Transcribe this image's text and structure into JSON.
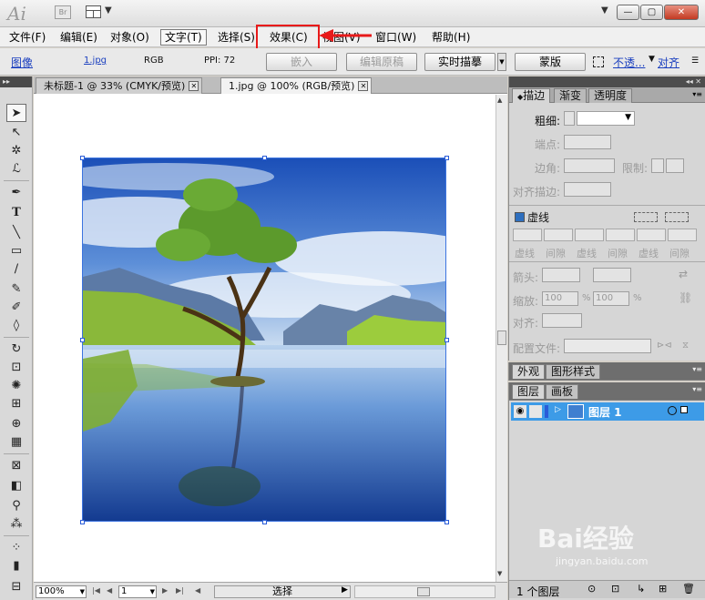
{
  "app": {
    "logo": "Ai",
    "bridge_label": "Br"
  },
  "window_controls": {
    "minimize": "—",
    "restore": "▢",
    "close": "✕"
  },
  "menu": {
    "items": [
      "文件(F)",
      "编辑(E)",
      "对象(O)",
      "文字(T)",
      "选择(S)",
      "效果(C)",
      "视图(V)",
      "窗口(W)",
      "帮助(H)"
    ]
  },
  "control_bar": {
    "type_label": "图像",
    "file_name": "1.jpg",
    "color_mode": "RGB",
    "ppi": "PPI: 72",
    "embed_button": "嵌入",
    "edit_original_button": "编辑原稿",
    "live_trace_button": "实时描摹",
    "mask_button": "蒙版",
    "opacity_link": "不透...",
    "align_link": "对齐"
  },
  "document": {
    "tabs": [
      {
        "label": "未标题-1 @ 33% (CMYK/预览)",
        "active": false
      },
      {
        "label": "1.jpg @ 100% (RGB/预览)",
        "active": true
      }
    ]
  },
  "status_bar": {
    "zoom": "100%",
    "page": "1",
    "tool_status": "选择"
  },
  "stroke_panel": {
    "tabs": [
      "描边",
      "渐变",
      "透明度"
    ],
    "weight_label": "粗细:",
    "cap_label": "端点:",
    "corner_label": "边角:",
    "limit_label": "限制:",
    "align_label": "对齐描边:",
    "dashed_label": "虚线",
    "dash_labels": [
      "虚线",
      "间隙",
      "虚线",
      "间隙",
      "虚线",
      "间隙"
    ],
    "arrow_label": "箭头:",
    "scale_label": "缩放:",
    "scale_value_1": "100",
    "scale_value_2": "100",
    "percent": "%",
    "align2_label": "对齐:",
    "profile_label": "配置文件:"
  },
  "appearance_panel": {
    "tabs": [
      "外观",
      "图形样式"
    ]
  },
  "layers_panel": {
    "tabs": [
      "图层",
      "画板"
    ],
    "layer_name": "图层 1",
    "layer_count": "1 个图层"
  },
  "watermark": {
    "text": "Bai经验",
    "url": "jingyan.baidu.com"
  },
  "colors": {
    "highlight_red": "#e81a1a",
    "selection_blue": "#3d9be7",
    "link_blue": "#1a3fbf"
  }
}
